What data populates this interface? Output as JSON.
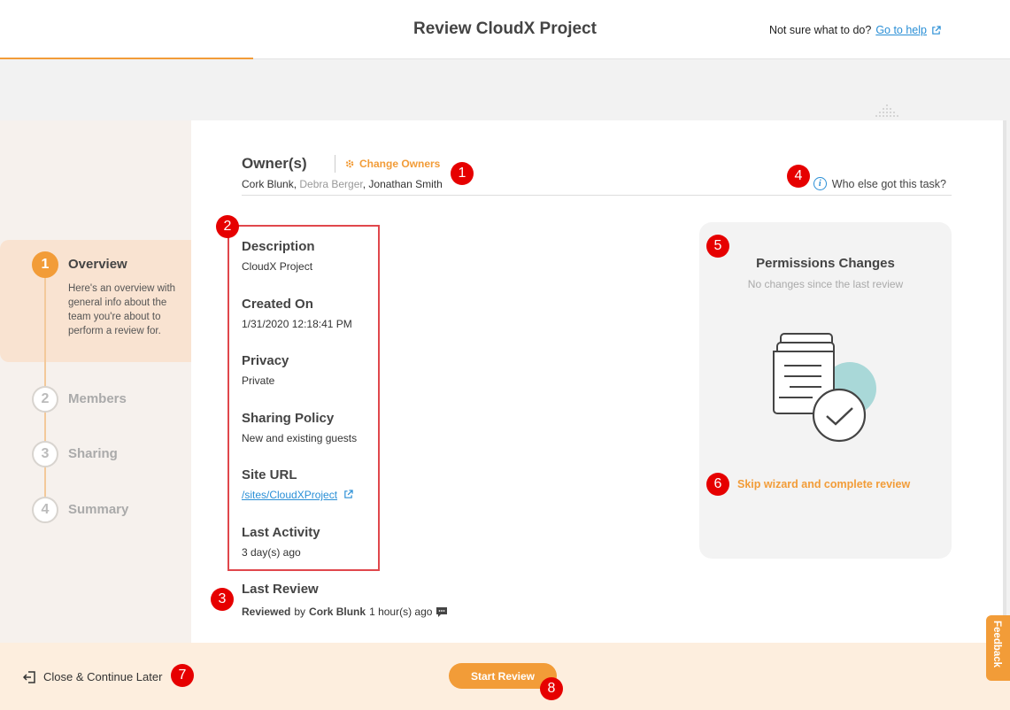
{
  "header": {
    "title": "Review CloudX Project",
    "help_prompt": "Not sure what to do?",
    "help_link": "Go to help"
  },
  "steps": [
    {
      "num": "1",
      "label": "Overview",
      "desc": "Here's an overview with general info about the team you're about to perform a review for.",
      "active": true
    },
    {
      "num": "2",
      "label": "Members"
    },
    {
      "num": "3",
      "label": "Sharing"
    },
    {
      "num": "4",
      "label": "Summary"
    }
  ],
  "owners": {
    "title": "Owner(s)",
    "change_label": "Change Owners",
    "list": [
      {
        "name": "Cork Blunk",
        "sep": ", "
      },
      {
        "name": "Debra Berger",
        "sep": ", ",
        "muted": true
      },
      {
        "name": "Jonathan Smith",
        "sep": ""
      }
    ],
    "who_else": "Who else got this task?"
  },
  "details": {
    "description": {
      "label": "Description",
      "value": "CloudX Project"
    },
    "created_on": {
      "label": "Created On",
      "value": "1/31/2020 12:18:41 PM"
    },
    "privacy": {
      "label": "Privacy",
      "value": "Private"
    },
    "sharing_policy": {
      "label": "Sharing Policy",
      "value": "New and existing guests"
    },
    "site_url": {
      "label": "Site URL",
      "value": "/sites/CloudXProject"
    },
    "last_activity": {
      "label": "Last Activity",
      "value": "3 day(s) ago"
    }
  },
  "last_review": {
    "label": "Last Review",
    "prefix": "Reviewed",
    "by": "by",
    "reviewer": "Cork Blunk",
    "when": "1 hour(s) ago"
  },
  "permissions": {
    "title": "Permissions Changes",
    "subtitle": "No changes since the last review",
    "skip_link": "Skip wizard and complete review"
  },
  "footer": {
    "close_label": "Close & Continue Later",
    "start_label": "Start Review",
    "feedback_label": "Feedback"
  },
  "markers": [
    "1",
    "2",
    "3",
    "4",
    "5",
    "6",
    "7",
    "8"
  ],
  "colors": {
    "accent": "#f29c38",
    "link": "#2a8fd6",
    "marker": "#e60000",
    "highlight_box": "#e0474c"
  }
}
